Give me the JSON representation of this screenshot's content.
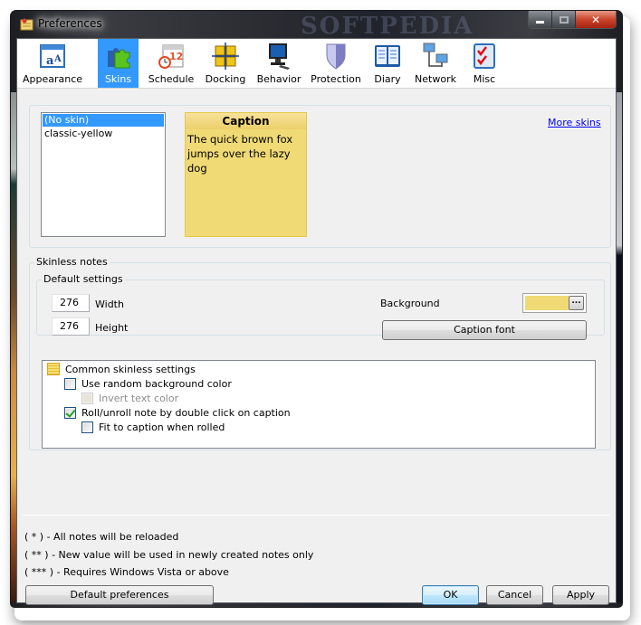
{
  "window": {
    "title": "Preferences",
    "watermark": "SOFTPEDIA",
    "controls": {
      "minimize": "minimize",
      "maximize": "maximize",
      "close": "✕"
    }
  },
  "toolbar": {
    "items": [
      {
        "label": "Appearance",
        "icon": "appearance-icon",
        "active": false
      },
      {
        "label": "Skins",
        "icon": "puzzle-icon",
        "active": true
      },
      {
        "label": "Schedule",
        "icon": "calendar-clock-icon",
        "active": false
      },
      {
        "label": "Docking",
        "icon": "docking-grid-icon",
        "active": false
      },
      {
        "label": "Behavior",
        "icon": "computer-mouse-icon",
        "active": false
      },
      {
        "label": "Protection",
        "icon": "shield-icon",
        "active": false
      },
      {
        "label": "Diary",
        "icon": "book-icon",
        "active": false
      },
      {
        "label": "Network",
        "icon": "network-computers-icon",
        "active": false
      },
      {
        "label": "Misc",
        "icon": "checklist-icon",
        "active": false
      }
    ]
  },
  "skins": {
    "list": [
      {
        "label": "(No skin)",
        "selected": true
      },
      {
        "label": "classic-yellow",
        "selected": false
      }
    ],
    "preview": {
      "caption": "Caption",
      "body": "The quick brown fox jumps over the lazy dog",
      "color": "#f0da75"
    },
    "more_link": "More skins"
  },
  "skinless": {
    "group_title": "Skinless notes",
    "defaults": {
      "group_title": "Default settings",
      "width_value": "276",
      "width_label": "Width",
      "height_value": "276",
      "height_label": "Height",
      "background_label": "Background",
      "background_color": "#f0da75",
      "picker_label": "...",
      "caption_font_button": "Caption font"
    },
    "tree": {
      "root_label": "Common skinless settings",
      "options": [
        {
          "label": "Use random background color",
          "checked": false,
          "enabled": true,
          "level": 1
        },
        {
          "label": "Invert text color",
          "checked": false,
          "enabled": false,
          "level": 2
        },
        {
          "label": "Roll/unroll note by double click on caption",
          "checked": true,
          "enabled": true,
          "level": 1
        },
        {
          "label": "Fit to caption when rolled",
          "checked": false,
          "enabled": true,
          "level": 2
        }
      ]
    }
  },
  "footnotes": [
    "( * ) - All notes will be reloaded",
    "( ** ) - New value will be used in newly created notes only",
    "( *** ) - Requires Windows Vista or above"
  ],
  "buttons": {
    "default_prefs": "Default preferences",
    "ok": "OK",
    "cancel": "Cancel",
    "apply": "Apply"
  }
}
